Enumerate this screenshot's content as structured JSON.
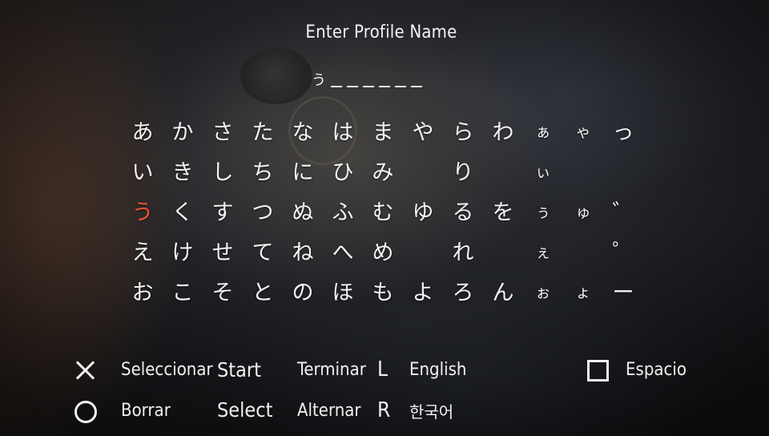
{
  "title": "Enter Profile Name",
  "entry": {
    "chars": [
      "う"
    ],
    "blank_count": 6
  },
  "kana_grid": [
    [
      "あ",
      "か",
      "さ",
      "た",
      "な",
      "は",
      "ま",
      "や",
      "ら",
      "わ",
      "ぁ",
      "ゃ",
      "っ"
    ],
    [
      "い",
      "き",
      "し",
      "ち",
      "に",
      "ひ",
      "み",
      "",
      "り",
      "",
      "ぃ",
      "",
      ""
    ],
    [
      "う",
      "く",
      "す",
      "つ",
      "ぬ",
      "ふ",
      "む",
      "ゆ",
      "る",
      "を",
      "ぅ",
      "ゅ",
      "゛"
    ],
    [
      "え",
      "け",
      "せ",
      "て",
      "ね",
      "へ",
      "め",
      "",
      "れ",
      "",
      "ぇ",
      "",
      "゜"
    ],
    [
      "お",
      "こ",
      "そ",
      "と",
      "の",
      "ほ",
      "も",
      "よ",
      "ろ",
      "ん",
      "ぉ",
      "ょ",
      "ー"
    ]
  ],
  "selected": {
    "row": 2,
    "col": 0
  },
  "colors": {
    "text": "#f2f2f2",
    "selected": "#e8542f"
  },
  "controls": {
    "cross_label": "Seleccionar",
    "circle_label": "Borrar",
    "start_key": "Start",
    "start_label": "Terminar",
    "select_key": "Select",
    "select_label": "Alternar",
    "l_key": "L",
    "l_label": "English",
    "r_key": "R",
    "r_label": "한국어",
    "square_label": "Espacio"
  },
  "icons": {
    "cross": "cross-button-icon",
    "circle": "circle-button-icon",
    "square": "square-button-icon"
  }
}
